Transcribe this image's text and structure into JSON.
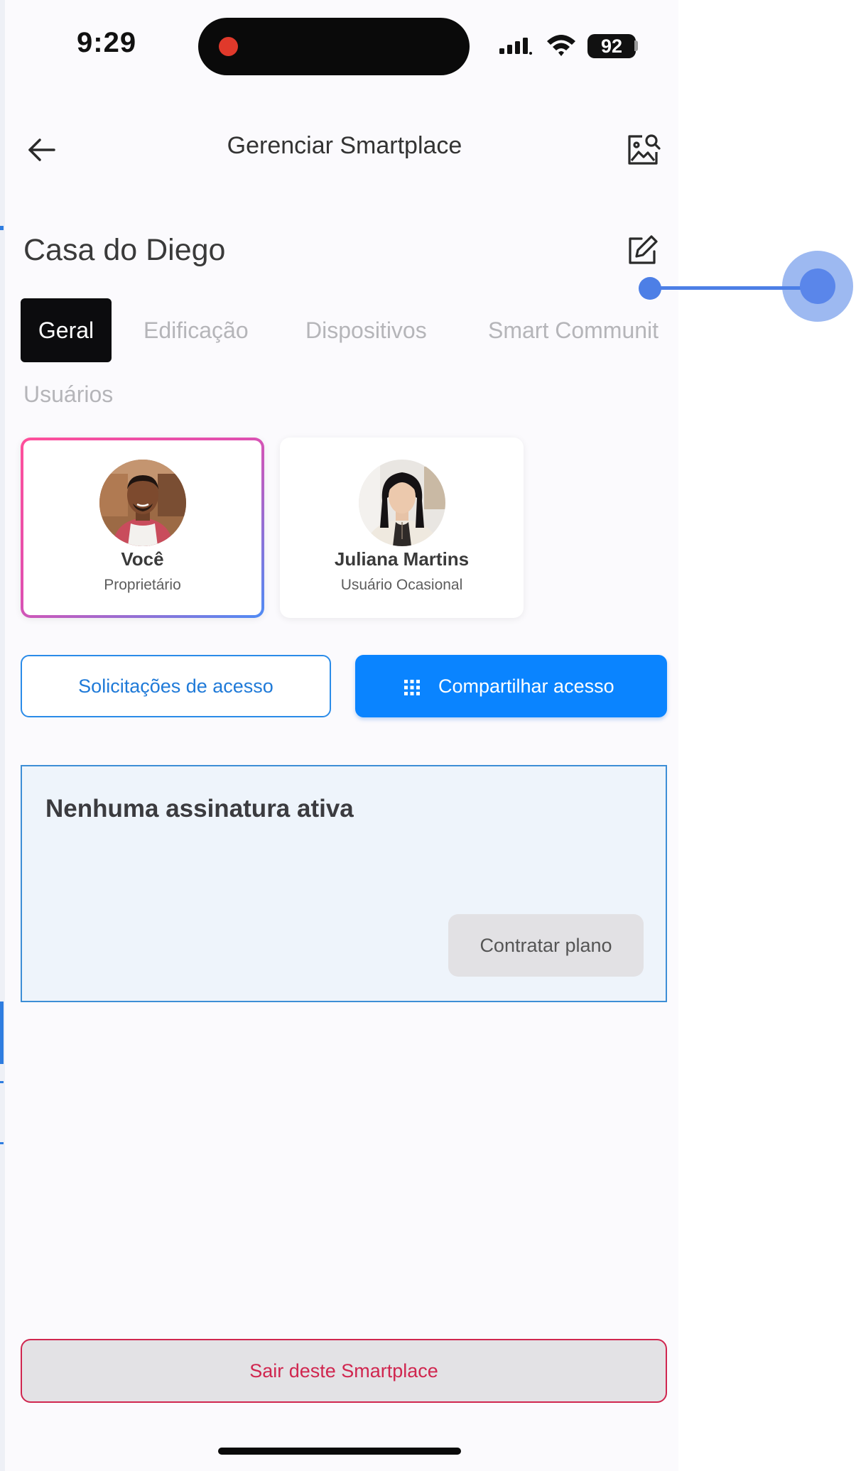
{
  "status_bar": {
    "time": "9:29",
    "battery": "92"
  },
  "header": {
    "title": "Gerenciar Smartplace"
  },
  "smartplace": {
    "name": "Casa do Diego"
  },
  "tabs": [
    {
      "label": "Geral",
      "active": true
    },
    {
      "label": "Edificação",
      "active": false
    },
    {
      "label": "Dispositivos",
      "active": false
    },
    {
      "label": "Smart Communit",
      "active": false
    },
    {
      "label": "Usuários",
      "active": false
    }
  ],
  "users": [
    {
      "name": "Você",
      "role": "Proprietário",
      "selected": true
    },
    {
      "name": "Juliana Martins",
      "role": "Usuário Ocasional",
      "selected": false
    }
  ],
  "actions": {
    "access_requests": "Solicitações de acesso",
    "share_access": "Compartilhar acesso"
  },
  "subscription": {
    "title": "Nenhuma assinatura ativa",
    "button": "Contratar plano"
  },
  "leave_button": "Sair deste Smartplace",
  "colors": {
    "accent": "#0a84ff",
    "danger": "#d0264f",
    "active_tab_bg": "#0c0c0e",
    "panel_bg": "#eef4fb",
    "gesture": "#4d7fe6"
  },
  "icons": {
    "back": "arrow-left-icon",
    "image_search": "image-search-icon",
    "edit": "edit-icon",
    "share": "grid-icon"
  }
}
